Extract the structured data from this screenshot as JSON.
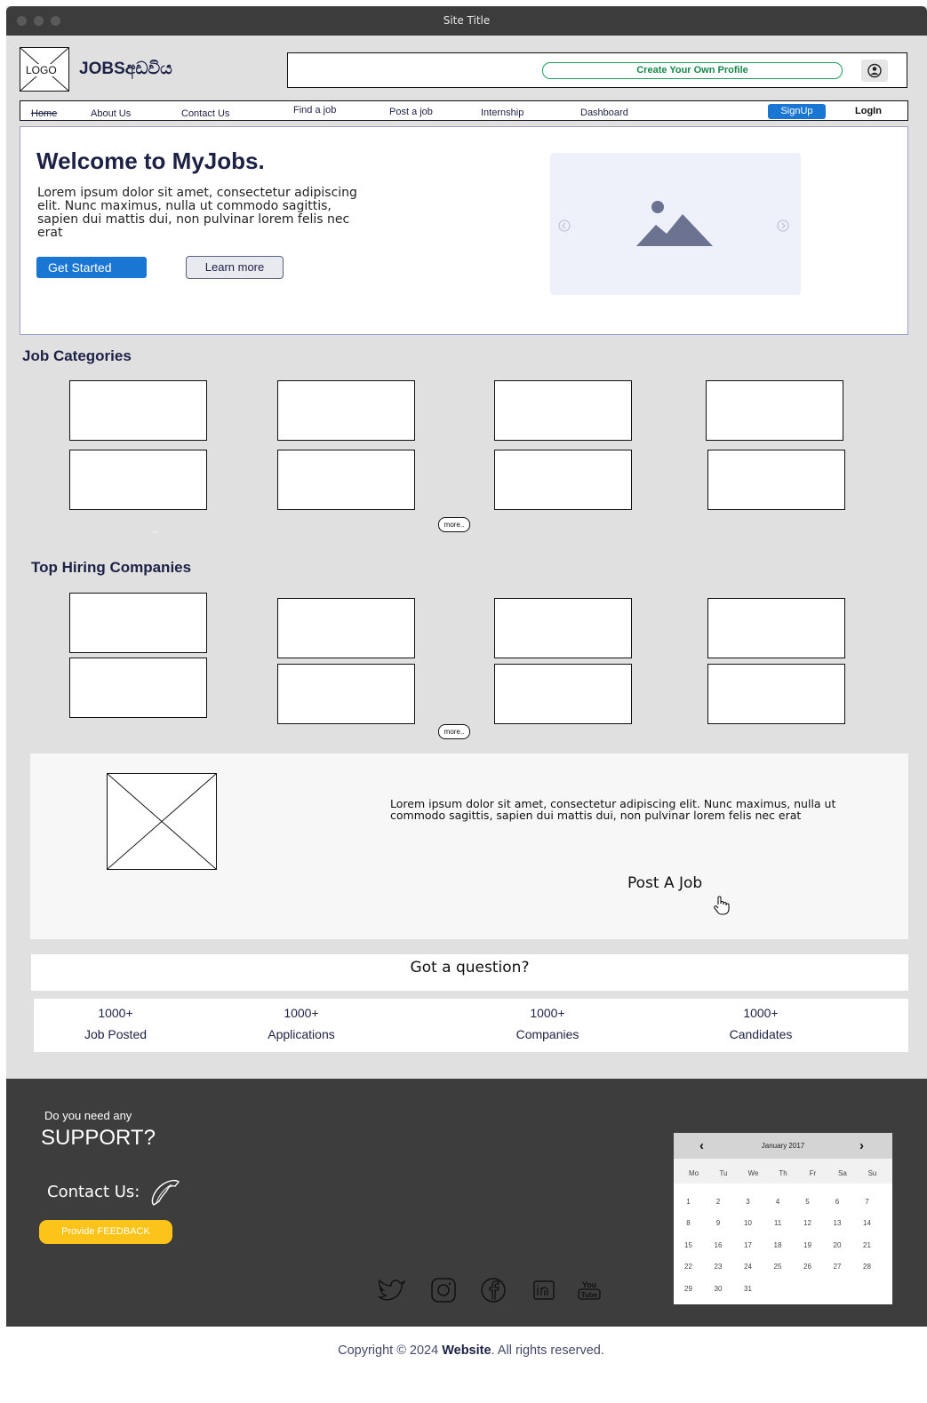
{
  "window": {
    "title": "Site Title"
  },
  "header": {
    "logo_text": "LOGO",
    "brand": "JOBSඅඩවිය",
    "create_profile": "Create Your Own Profile"
  },
  "nav": {
    "items": [
      {
        "label": "Home"
      },
      {
        "label": "About Us"
      },
      {
        "label": "Contact Us"
      },
      {
        "label": "Find a job"
      },
      {
        "label": "Post a job"
      },
      {
        "label": "Internship"
      },
      {
        "label": "Dashboard"
      }
    ],
    "signup": "SignUp",
    "login": "LogIn"
  },
  "hero": {
    "title": "Welcome to MyJobs.",
    "text": "Lorem ipsum dolor sit amet, consectetur adipiscing elit. Nunc maximus, nulla ut commodo sagittis, sapien dui mattis dui, non pulvinar lorem felis nec erat",
    "primary": "Get Started",
    "secondary": "Learn more"
  },
  "categories": {
    "title": "Job Categories",
    "more": "more.."
  },
  "companies": {
    "title": "Top Hiring Companies",
    "more": "more.."
  },
  "promo": {
    "text": "Lorem ipsum dolor sit amet, consectetur adipiscing elit. Nunc maximus, nulla ut commodo sagittis, sapien dui mattis dui, non pulvinar lorem felis nec erat",
    "cta": "Post A Job"
  },
  "question": "Got a question?",
  "stats": [
    {
      "n": "1000+",
      "l": "Job Posted"
    },
    {
      "n": "1000+",
      "l": "Applications"
    },
    {
      "n": "1000+",
      "l": "Companies"
    },
    {
      "n": "1000+",
      "l": "Candidates"
    }
  ],
  "footer": {
    "support_small": "Do you need any",
    "support_big": "SUPPORT?",
    "contact": "Contact Us:",
    "feedback": "Provide FEEDBACK",
    "social": [
      "twitter-icon",
      "instagram-icon",
      "facebook-icon",
      "linkedin-icon",
      "youtube-icon"
    ]
  },
  "calendar": {
    "month": "January 2017",
    "prev": "‹",
    "next": "›",
    "dow": [
      "Mo",
      "Tu",
      "We",
      "Th",
      "Fr",
      "Sa",
      "Su"
    ],
    "weeks": [
      [
        "1",
        "2",
        "3",
        "4",
        "5",
        "6",
        "7"
      ],
      [
        "8",
        "9",
        "10",
        "11",
        "12",
        "13",
        "14"
      ],
      [
        "15",
        "16",
        "17",
        "18",
        "19",
        "20",
        "21"
      ],
      [
        "22",
        "23",
        "24",
        "25",
        "26",
        "27",
        "28"
      ],
      [
        "29",
        "30",
        "31",
        "",
        "",
        "",
        ""
      ]
    ]
  },
  "copyright": {
    "pre": "Copyright © 2024 ",
    "site": "Website",
    "post": ". All rights reserved."
  },
  "colors": {
    "accent": "#1976d2",
    "footer": "#3d3d3d",
    "feedback": "#fcc419",
    "profile": "#21a05c"
  }
}
